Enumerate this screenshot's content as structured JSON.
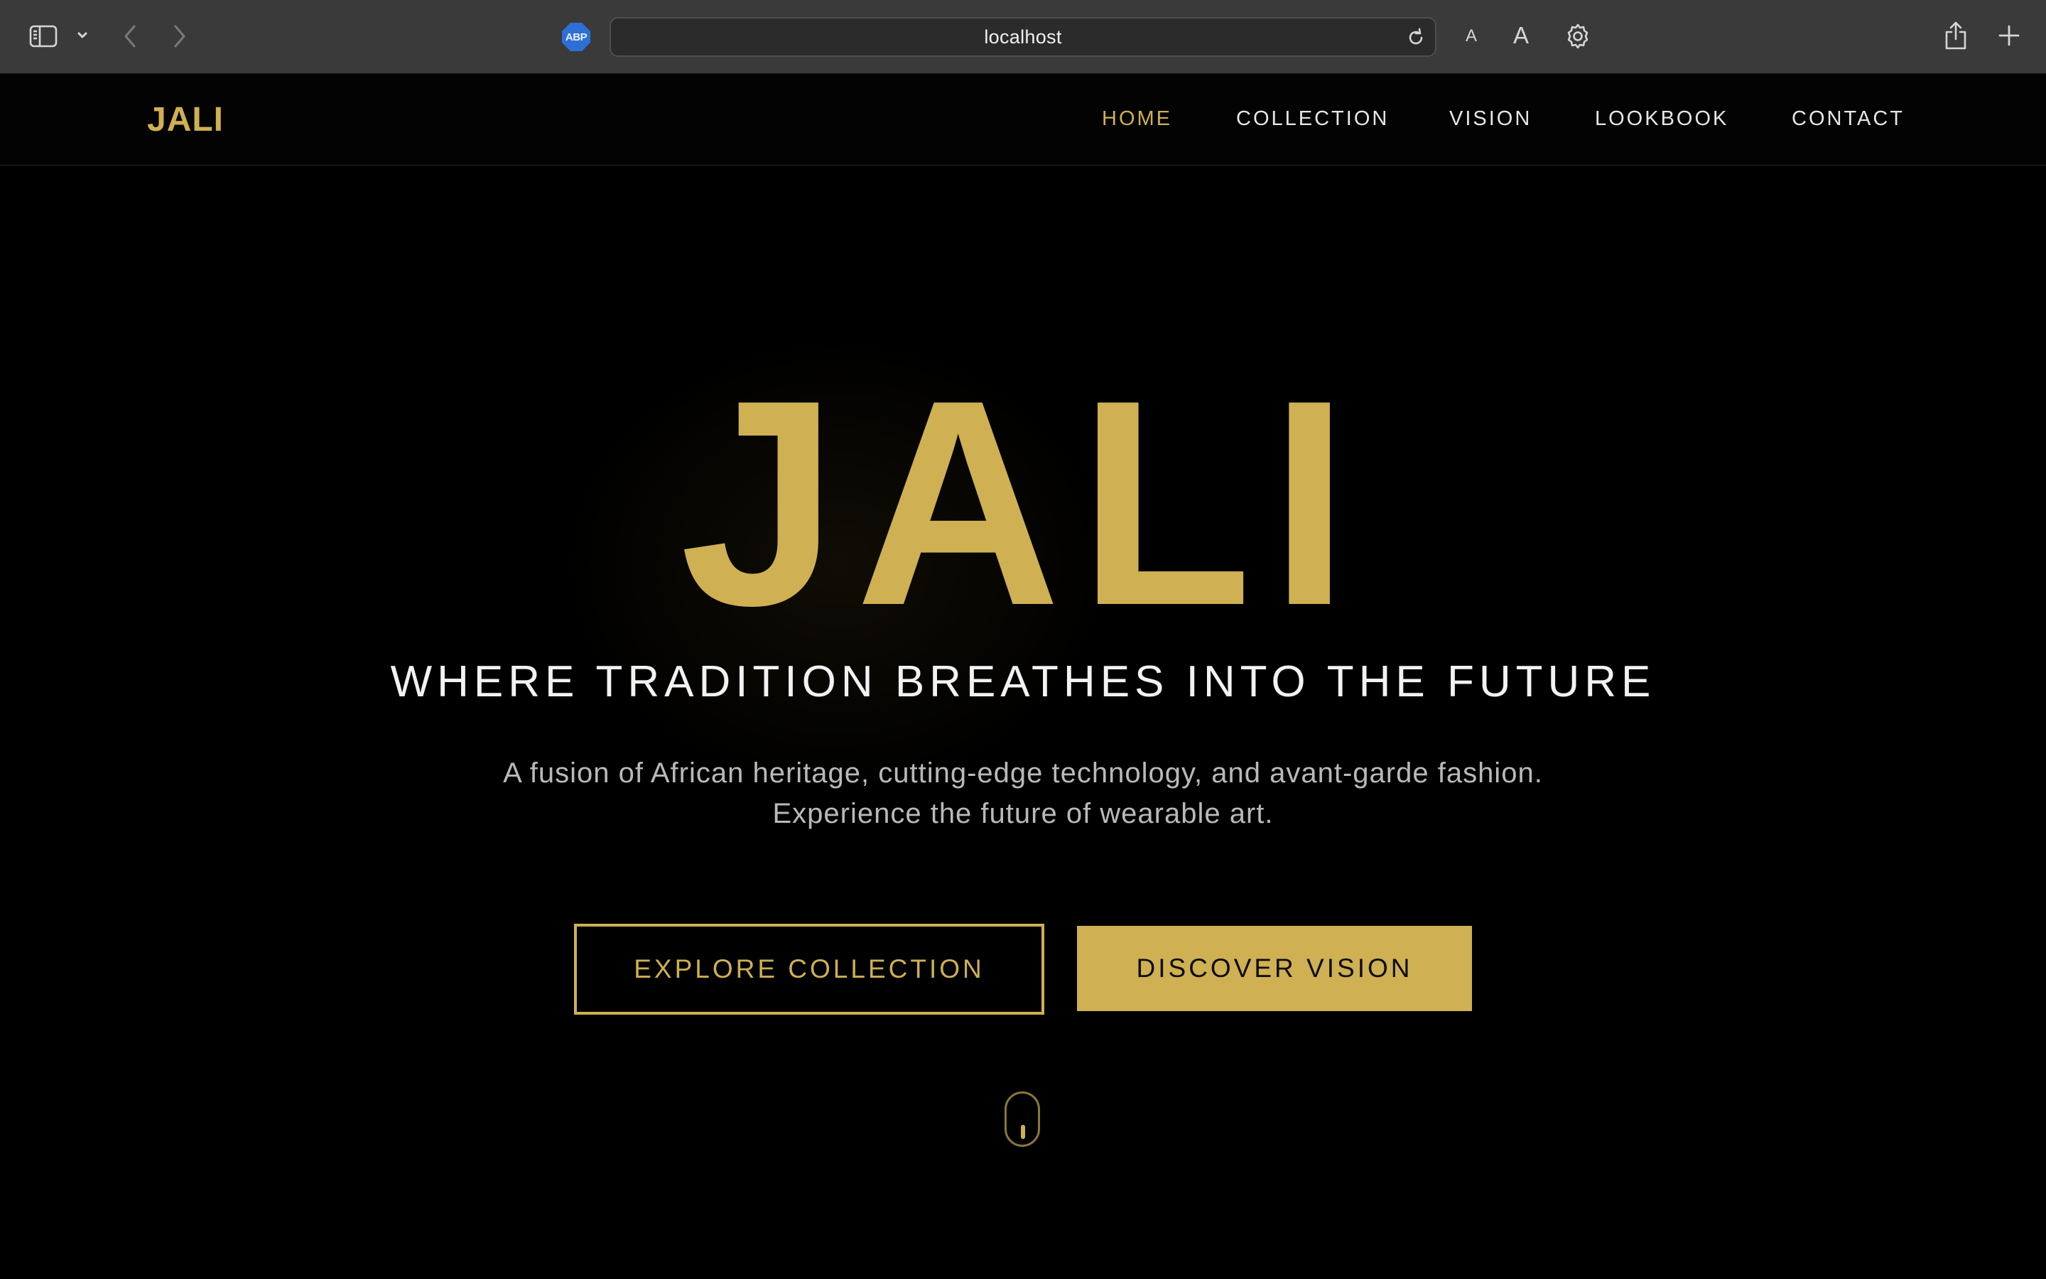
{
  "browser": {
    "url": "localhost",
    "icons": {
      "sidebar": "sidebar-icon",
      "tab_menu": "chevron-down-icon",
      "back": "back-arrow-icon",
      "forward": "forward-arrow-icon",
      "extension": "adblock-plus-icon",
      "reload": "reload-icon",
      "text_smaller": "text-smaller-icon",
      "text_larger": "text-larger-icon",
      "settings": "gear-icon",
      "share": "share-icon",
      "new_tab": "plus-icon"
    },
    "extension_badge": "ABP",
    "text_small_glyph": "A",
    "text_large_glyph": "A"
  },
  "site": {
    "logo": "JALI",
    "nav": [
      {
        "label": "HOME",
        "active": true
      },
      {
        "label": "COLLECTION",
        "active": false
      },
      {
        "label": "VISION",
        "active": false
      },
      {
        "label": "LOOKBOOK",
        "active": false
      },
      {
        "label": "CONTACT",
        "active": false
      }
    ]
  },
  "hero": {
    "title": "JALI",
    "tagline": "WHERE TRADITION BREATHES INTO THE FUTURE",
    "description_lines": [
      "A fusion of African heritage, cutting-edge technology, and avant-garde fashion.",
      "Experience the future of wearable art."
    ],
    "buttons": {
      "explore": "EXPLORE COLLECTION",
      "discover": "DISCOVER VISION"
    },
    "scroll_indicator_icon": "mouse-scroll-icon"
  },
  "colors": {
    "accent_gold": "#cfb052",
    "background": "#000000",
    "chrome": "#3a3a3a"
  }
}
